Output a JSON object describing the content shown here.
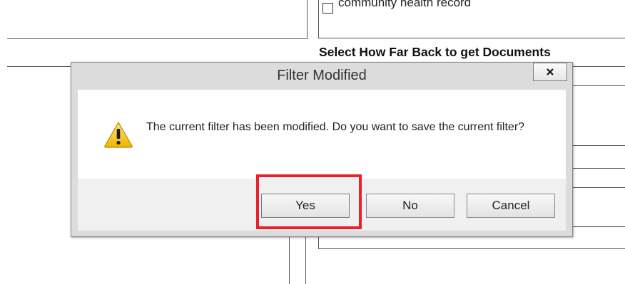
{
  "background": {
    "checkbox_label": "community health record",
    "section_heading": "Select How Far Back to get Documents"
  },
  "dialog": {
    "title": "Filter Modified",
    "close_label": "x",
    "message": "The current filter has been modified.  Do you want to save the current filter?",
    "icon": "warning-icon",
    "buttons": {
      "yes": "Yes",
      "no": "No",
      "cancel": "Cancel"
    }
  },
  "annotation": {
    "highlight_target": "yes-button",
    "highlight_color": "#e8212a"
  }
}
